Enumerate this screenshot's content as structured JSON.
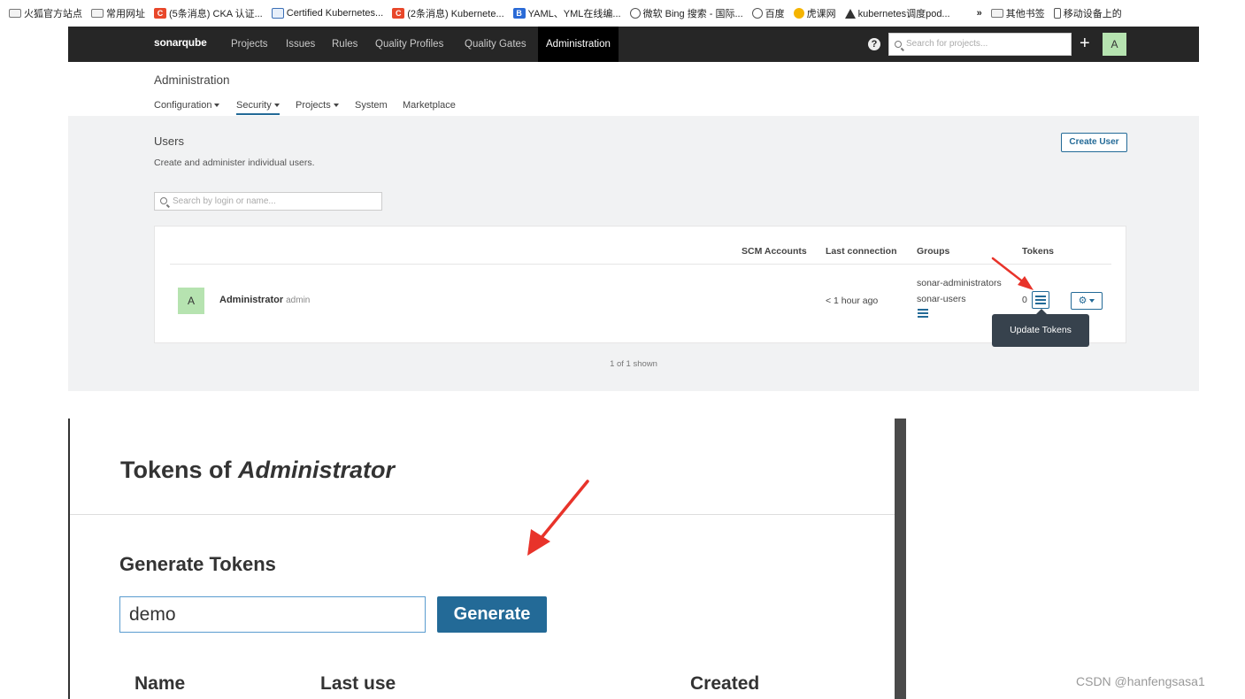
{
  "bookmarks": [
    {
      "icon": "folder-icon",
      "label": "火狐官方站点"
    },
    {
      "icon": "folder-icon",
      "label": "常用网址"
    },
    {
      "icon": "csdn-icon",
      "label": "(5条消息) CKA 认证..."
    },
    {
      "icon": "kubernetes-icon",
      "label": "Certified Kubernetes..."
    },
    {
      "icon": "csdn-icon",
      "label": "(2条消息) Kubernete..."
    },
    {
      "icon": "bokeyuan-icon",
      "label": "YAML、YML在线编..."
    },
    {
      "icon": "globe-icon",
      "label": "微软 Bing 搜索 - 国际..."
    },
    {
      "icon": "globe-icon",
      "label": "百度"
    },
    {
      "icon": "hukewang-icon",
      "label": "虎课网"
    },
    {
      "icon": "mark-icon",
      "label": "kubernetes调度pod..."
    }
  ],
  "bookmarks_more": "»",
  "bookmarks_right": [
    {
      "icon": "folder-icon",
      "label": "其他书签"
    },
    {
      "icon": "mobile-icon",
      "label": "移动设备上的"
    }
  ],
  "nav": {
    "logo": "sonarqube",
    "links": [
      "Projects",
      "Issues",
      "Rules",
      "Quality Profiles",
      "Quality Gates",
      "Administration"
    ],
    "active": "Administration",
    "help": "?",
    "search_placeholder": "Search for projects...",
    "plus": "+",
    "avatar": "A"
  },
  "admin": {
    "title": "Administration",
    "tabs": [
      "Configuration",
      "Security",
      "Projects",
      "System",
      "Marketplace"
    ],
    "active_tab": "Security"
  },
  "users": {
    "title": "Users",
    "description": "Create and administer individual users.",
    "create_button": "Create User",
    "search_placeholder": "Search by login or name...",
    "columns": [
      "SCM Accounts",
      "Last connection",
      "Groups",
      "Tokens"
    ],
    "rows": [
      {
        "avatar": "A",
        "name": "Administrator",
        "login": "admin",
        "last_connection": "< 1 hour ago",
        "groups": [
          "sonar-administrators",
          "sonar-users"
        ],
        "tokens": "0"
      }
    ],
    "tooltip": "Update Tokens",
    "shown": "1 of 1 shown"
  },
  "modal": {
    "title_prefix": "Tokens of ",
    "title_user": "Administrator",
    "generate_heading": "Generate Tokens",
    "token_name": "demo",
    "generate_button": "Generate",
    "columns": [
      "Name",
      "Last use",
      "Created"
    ]
  },
  "watermark": "CSDN @hanfengsasa1",
  "colors": {
    "accent": "#236a97",
    "nav_bg": "#262626",
    "avatar": "#b6e3b0",
    "arrow": "#e8332a"
  }
}
